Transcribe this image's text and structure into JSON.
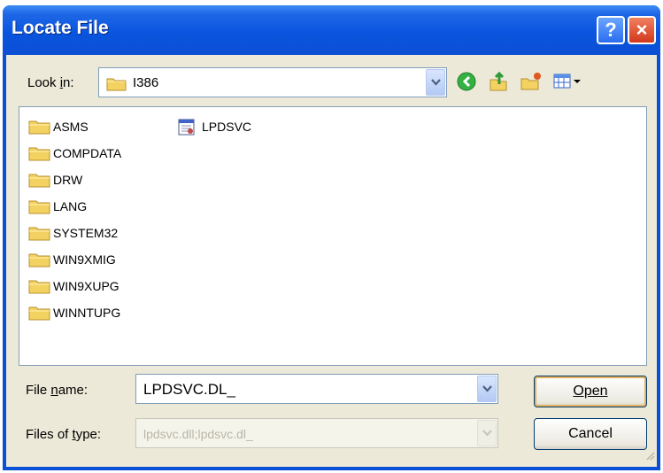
{
  "dialog": {
    "title": "Locate File",
    "help_glyph": "?",
    "close_glyph": "×"
  },
  "look_in": {
    "label": "Look in:",
    "value": "I386",
    "icons": [
      "folder-icon",
      "back-icon",
      "up-folder-icon",
      "new-folder-icon",
      "view-menu-icon"
    ]
  },
  "files": {
    "folders": [
      "ASMS",
      "COMPDATA",
      "DRW",
      "LANG",
      "SYSTEM32",
      "WIN9XMIG",
      "WIN9XUPG",
      "WINNTUPG"
    ],
    "documents": [
      "LPDSVC"
    ]
  },
  "file_name": {
    "label": "File name:",
    "value": "LPDSVC.DL_"
  },
  "file_type": {
    "label": "Files of type:",
    "value": "lpdsvc.dll;lpdsvc.dl_"
  },
  "buttons": {
    "open": "Open",
    "cancel": "Cancel"
  },
  "colors": {
    "titlebar": "#0a55df",
    "client": "#ece9d8",
    "folder": "#f3d262"
  }
}
